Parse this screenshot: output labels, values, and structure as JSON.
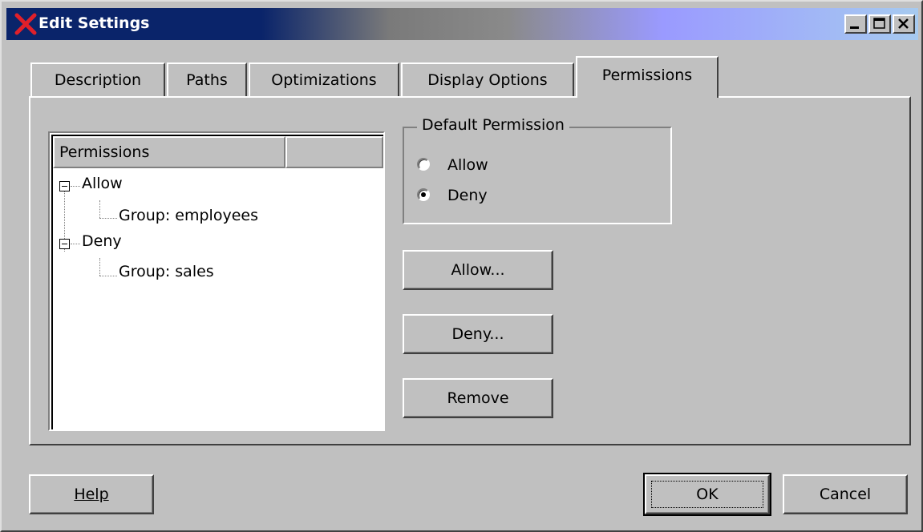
{
  "window": {
    "title": "Edit Settings",
    "controls": [
      "minimize",
      "maximize",
      "close"
    ]
  },
  "tabs": [
    {
      "label": "Description",
      "active": false
    },
    {
      "label": "Paths",
      "active": false
    },
    {
      "label": "Optimizations",
      "active": false
    },
    {
      "label": "Display Options",
      "active": false
    },
    {
      "label": "Permissions",
      "active": true
    }
  ],
  "permissions_tree": {
    "column_header": "Permissions",
    "nodes": [
      {
        "label": "Allow",
        "children": [
          "Group: employees"
        ]
      },
      {
        "label": "Deny",
        "children": [
          "Group: sales"
        ]
      }
    ]
  },
  "default_permission": {
    "title": "Default Permission",
    "options": [
      {
        "label": "Allow",
        "selected": false
      },
      {
        "label": "Deny",
        "selected": true
      }
    ]
  },
  "actions": {
    "allow_label": "Allow...",
    "deny_label": "Deny...",
    "remove_label": "Remove"
  },
  "footer": {
    "help_label": "Help",
    "ok_label": "OK",
    "cancel_label": "Cancel"
  },
  "colors": {
    "title_bar": "#0a246a",
    "face": "#c0c0c0",
    "close_x": "#e0202a"
  }
}
